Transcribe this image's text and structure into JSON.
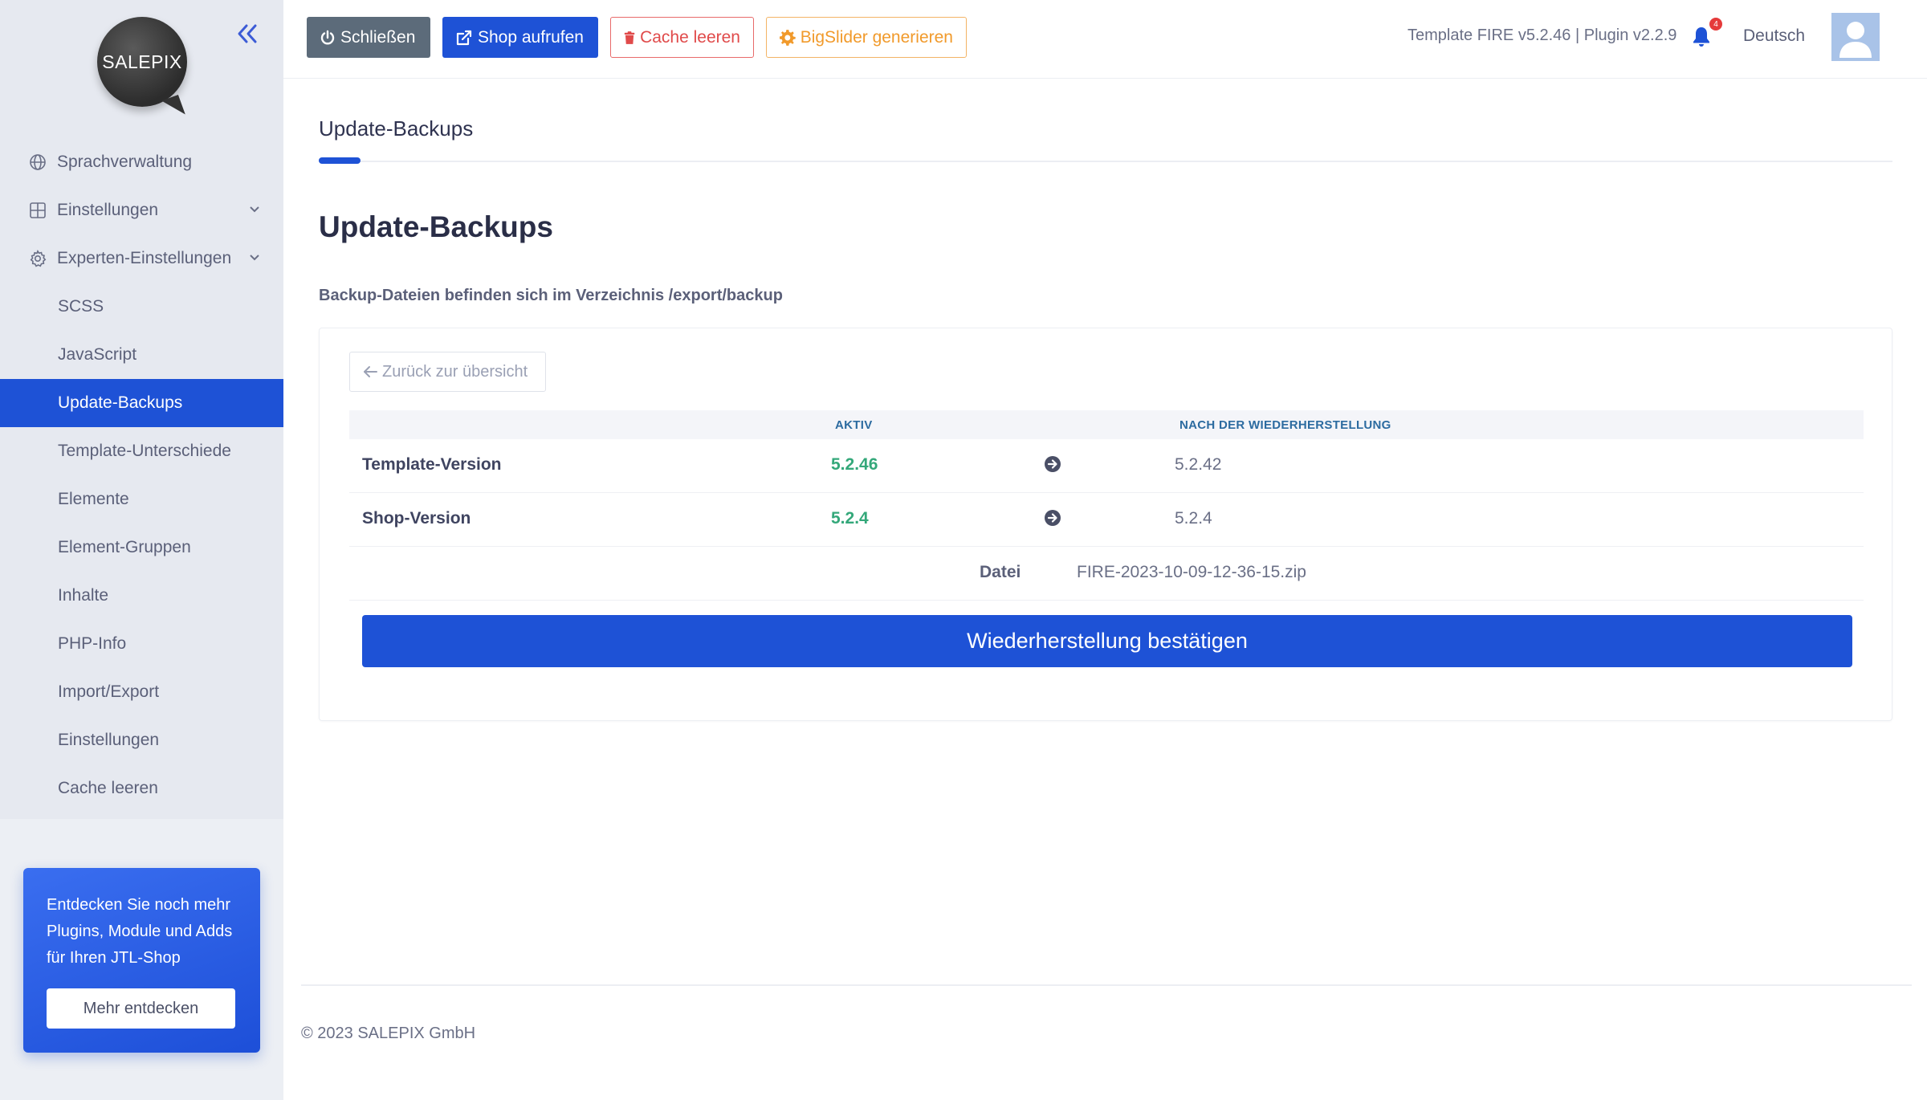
{
  "sidebar": {
    "logo_text": "SALEPIX",
    "items": [
      {
        "label": "Sprachverwaltung",
        "icon": "globe-icon"
      },
      {
        "label": "Einstellungen",
        "icon": "grid-icon"
      },
      {
        "label": "Experten-Einstellungen",
        "icon": "gear-icon"
      }
    ],
    "subitems": [
      "SCSS",
      "JavaScript",
      "Update-Backups",
      "Template-Unterschiede",
      "Elemente",
      "Element-Gruppen",
      "Inhalte",
      "PHP-Info",
      "Import/Export",
      "Einstellungen",
      "Cache leeren"
    ],
    "active_subitem": "Update-Backups",
    "promo": {
      "text": "Entdecken Sie noch mehr Plugins, Module und Adds für Ihren JTL-Shop",
      "button": "Mehr entdecken"
    }
  },
  "header": {
    "buttons": {
      "close": "Schließen",
      "shop": "Shop aufrufen",
      "cache": "Cache leeren",
      "slider": "BigSlider generieren"
    },
    "version": "Template FIRE v5.2.46 | Plugin v2.2.9",
    "notification_count": "4",
    "language": "Deutsch"
  },
  "main": {
    "tab": "Update-Backups",
    "title": "Update-Backups",
    "subtitle": "Backup-Dateien befinden sich im Verzeichnis /export/backup",
    "back_button": "Zurück zur übersicht",
    "table": {
      "col_active": "AKTIV",
      "col_after": "NACH DER WIEDERHERSTELLUNG",
      "rows": [
        {
          "label": "Template-Version",
          "active": "5.2.46",
          "after": "5.2.42"
        },
        {
          "label": "Shop-Version",
          "active": "5.2.4",
          "after": "5.2.4"
        }
      ],
      "file_label": "Datei",
      "file_value": "FIRE-2023-10-09-12-36-15.zip"
    },
    "confirm_button": "Wiederherstellung bestätigen"
  },
  "footer": {
    "copyright": "© 2023 SALEPIX GmbH"
  },
  "colors": {
    "primary": "#1e52d6",
    "success": "#34a87a",
    "danger": "#e04a4a",
    "warning": "#f19a2b",
    "sidebar_bg": "#e6e9f0"
  }
}
